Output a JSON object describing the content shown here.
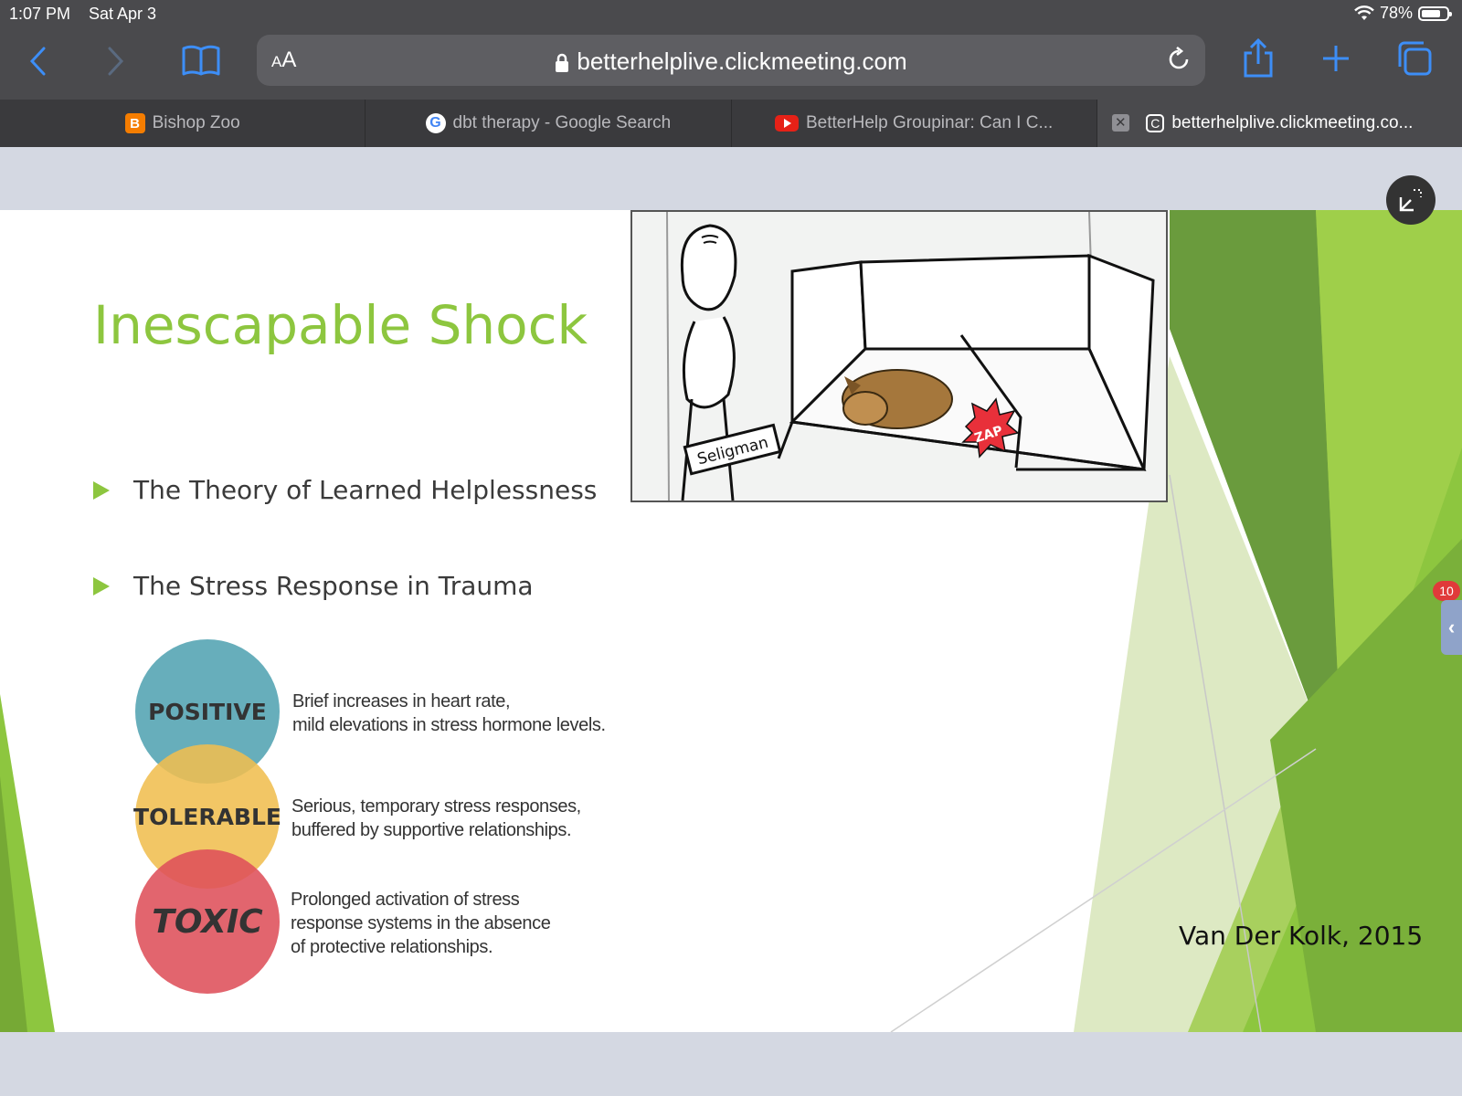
{
  "status_bar": {
    "time": "1:07 PM",
    "date": "Sat Apr 3",
    "battery": "78%",
    "battery_level": 0.78
  },
  "toolbar": {
    "text_size_label_small": "A",
    "text_size_label_large": "A",
    "url": "betterhelplive.clickmeeting.com",
    "icons": [
      "back-icon",
      "forward-icon",
      "bookmarks-icon",
      "lock-icon",
      "reload-icon",
      "share-icon",
      "new-tab-icon",
      "tabs-icon"
    ]
  },
  "tabs": [
    {
      "label": "Bishop Zoo",
      "icon": "blogger-icon",
      "active": false
    },
    {
      "label": "dbt therapy - Google Search",
      "icon": "google-icon",
      "active": false
    },
    {
      "label": "BetterHelp Groupinar: Can I C...",
      "icon": "youtube-icon",
      "active": false
    },
    {
      "label": "betterhelplive.clickmeeting.co...",
      "icon": "clickmeeting-icon",
      "active": true
    }
  ],
  "slide": {
    "title": "Inescapable Shock",
    "bullets": [
      "The Theory of Learned Helplessness",
      "The Stress Response in Trauma"
    ],
    "cartoon": {
      "sign_label": "Seligman",
      "zap_label": "ZAP"
    },
    "stress_levels": [
      {
        "label": "POSITIVE",
        "lines": [
          "Brief increases in heart rate,",
          "mild elevations in stress hormone levels."
        ],
        "color": "#56a5b4"
      },
      {
        "label": "TOLERABLE",
        "lines": [
          "Serious, temporary stress responses,",
          "buffered by supportive relationships."
        ],
        "color": "#f0be50"
      },
      {
        "label": "TOXIC",
        "lines": [
          "Prolonged activation of stress",
          "response systems in the absence",
          "of protective relationships."
        ],
        "color": "#de505a"
      }
    ],
    "citation": "Van Der Kolk, 2015",
    "accent_color": "#8dc63f"
  },
  "side_panel": {
    "badge_count": "10"
  }
}
